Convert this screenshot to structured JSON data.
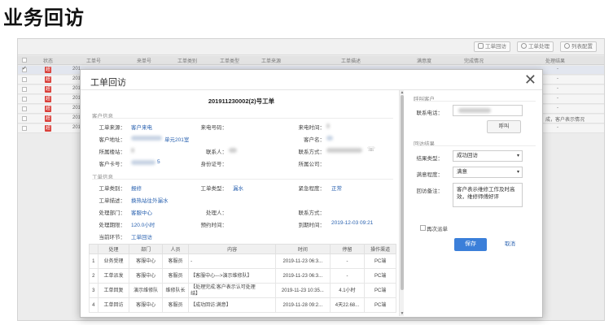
{
  "page_title": "业务回访",
  "toolbar": {
    "order_visit": "工单回访",
    "order_handle": "工单处理",
    "list_config": "列表配置"
  },
  "grid": {
    "columns": [
      "状态",
      "工单号",
      "来单号",
      "工单类别",
      "工单类型",
      "工单来源",
      "工单描述",
      "满意度",
      "完成情况",
      "处理结果"
    ],
    "rows": [
      {
        "badge": "超",
        "num": "201",
        "result": "-"
      },
      {
        "badge": "超",
        "num": "201",
        "result": "-"
      },
      {
        "badge": "超",
        "num": "201",
        "result": "-"
      },
      {
        "badge": "超",
        "num": "201",
        "result": "-"
      },
      {
        "badge": "超",
        "num": "201",
        "result": "-"
      },
      {
        "badge": "超",
        "num": "201",
        "result": "成，客户表示情况"
      },
      {
        "badge": "超",
        "num": "201",
        "result": "-"
      }
    ]
  },
  "modal": {
    "title": "工单回访",
    "order_no": "201911230002(2)号工单",
    "customer_section": "客户信息",
    "customer": {
      "source_label": "工单来源：",
      "source_value": "客户来电",
      "phone_label": "来电号码：",
      "time_label": "来电时间：",
      "addr_label": "客户地址：",
      "addr_value": "单元201室",
      "name_label": "客户名：",
      "belong_label": "所属楼站：",
      "contact_label": "联系人：",
      "contact_way_label": "联系方式：",
      "cardno_label": "客户卡号：",
      "cardno_value": "5",
      "idno_label": "身份证号：",
      "company_label": "所属公司："
    },
    "order_section": "工单信息",
    "order": {
      "category_label": "工单类别：",
      "category_value": "报修",
      "type_label": "工单类型：",
      "type_value": "漏水",
      "urgency_label": "紧急程度：",
      "urgency_value": "正常",
      "desc_label": "工单描述：",
      "desc_value": "换热站往外漏水",
      "dept_label": "处理部门：",
      "dept_value": "客服中心",
      "handler_label": "处理人：",
      "handler_contact_label": "联系方式：",
      "deadline_label": "处理期限：",
      "deadline_value": "120.0小时",
      "appoint_label": "预约时间：",
      "due_label": "到期时间：",
      "due_value": "2019-12-03 09:21",
      "current_label": "当前环节：",
      "current_value": "工单回访"
    },
    "table": {
      "headers": [
        "处理",
        "部门",
        "人员",
        "内容",
        "时间",
        "停留",
        "操作渠道"
      ],
      "rows": [
        {
          "no": "1",
          "step": "业务受理",
          "dept": "客服中心",
          "person": "客服员",
          "content": "-",
          "time": "2019-11-23 06:3...",
          "stay": "-",
          "channel": "PC端"
        },
        {
          "no": "2",
          "step": "工单派发",
          "dept": "客服中心",
          "person": "客服员",
          "content": "【客服中心--->演示维修队】",
          "time": "2019-11-23 06:3...",
          "stay": "-",
          "channel": "PC端"
        },
        {
          "no": "3",
          "step": "工单回复",
          "dept": "演示维修队",
          "person": "维修队长",
          "content": "【处理完成;客户表示认可处理\n结】",
          "time": "2019-11-23 10:35...",
          "stay": "4.1小时",
          "channel": "PC端"
        },
        {
          "no": "4",
          "step": "工单回访",
          "dept": "客服中心",
          "person": "客服员",
          "content": "【成功回访:满意】",
          "time": "2019-11-28 09:2...",
          "stay": "4天22.68...",
          "channel": "PC端"
        }
      ]
    },
    "call_section": "呼叫客户",
    "phone_label": "联系电话：",
    "call_button": "呼叫",
    "visit_section": "回访结果",
    "result_label": "结果类型：",
    "result_value": "成功回访",
    "satisfaction_label": "满意程度：",
    "satisfaction_value": "满意",
    "remark_label": "回访备注：",
    "remark_value": "客户表示维修工作及时高效，维修师傅好评",
    "redispatch_label": "再次派单",
    "save_button": "保存",
    "cancel_button": "取消"
  },
  "colors": {
    "accent": "#3b7fd9",
    "link": "#2a62b0",
    "badge": "#d9403a"
  }
}
